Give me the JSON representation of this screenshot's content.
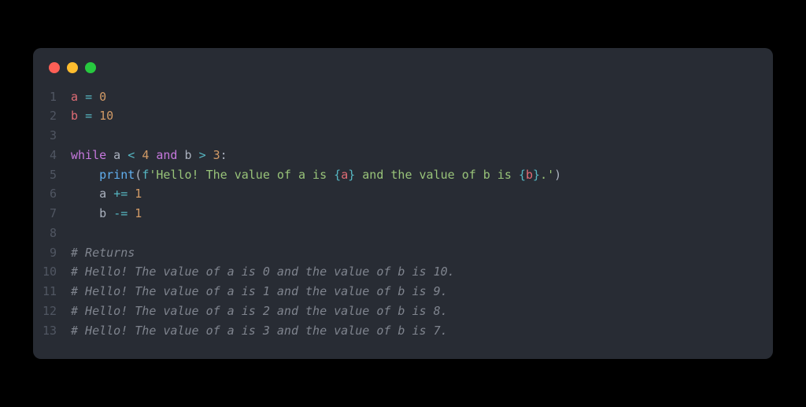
{
  "window": {
    "traffic_lights": [
      "red",
      "yellow",
      "green"
    ]
  },
  "code": {
    "lines": [
      {
        "n": "1",
        "tokens": [
          {
            "t": "a ",
            "c": "tok-var"
          },
          {
            "t": "=",
            "c": "tok-op"
          },
          {
            "t": " ",
            "c": "tok-plain"
          },
          {
            "t": "0",
            "c": "tok-num"
          }
        ]
      },
      {
        "n": "2",
        "tokens": [
          {
            "t": "b ",
            "c": "tok-var"
          },
          {
            "t": "=",
            "c": "tok-op"
          },
          {
            "t": " ",
            "c": "tok-plain"
          },
          {
            "t": "10",
            "c": "tok-num"
          }
        ]
      },
      {
        "n": "3",
        "tokens": []
      },
      {
        "n": "4",
        "tokens": [
          {
            "t": "while",
            "c": "tok-kw"
          },
          {
            "t": " a ",
            "c": "tok-plain"
          },
          {
            "t": "<",
            "c": "tok-op"
          },
          {
            "t": " ",
            "c": "tok-plain"
          },
          {
            "t": "4",
            "c": "tok-num"
          },
          {
            "t": " ",
            "c": "tok-plain"
          },
          {
            "t": "and",
            "c": "tok-kw"
          },
          {
            "t": " b ",
            "c": "tok-plain"
          },
          {
            "t": ">",
            "c": "tok-op"
          },
          {
            "t": " ",
            "c": "tok-plain"
          },
          {
            "t": "3",
            "c": "tok-num"
          },
          {
            "t": ":",
            "c": "tok-plain"
          }
        ]
      },
      {
        "n": "5",
        "tokens": [
          {
            "t": "    ",
            "c": "tok-plain"
          },
          {
            "t": "print",
            "c": "tok-fn"
          },
          {
            "t": "(",
            "c": "tok-plain"
          },
          {
            "t": "f",
            "c": "tok-fstr"
          },
          {
            "t": "'Hello! The value of a is ",
            "c": "tok-str"
          },
          {
            "t": "{",
            "c": "tok-op"
          },
          {
            "t": "a",
            "c": "tok-var"
          },
          {
            "t": "}",
            "c": "tok-op"
          },
          {
            "t": " and the value of b is ",
            "c": "tok-str"
          },
          {
            "t": "{",
            "c": "tok-op"
          },
          {
            "t": "b",
            "c": "tok-var"
          },
          {
            "t": "}",
            "c": "tok-op"
          },
          {
            "t": ".'",
            "c": "tok-str"
          },
          {
            "t": ")",
            "c": "tok-plain"
          }
        ]
      },
      {
        "n": "6",
        "tokens": [
          {
            "t": "    a ",
            "c": "tok-plain"
          },
          {
            "t": "+=",
            "c": "tok-op"
          },
          {
            "t": " ",
            "c": "tok-plain"
          },
          {
            "t": "1",
            "c": "tok-num"
          }
        ]
      },
      {
        "n": "7",
        "tokens": [
          {
            "t": "    b ",
            "c": "tok-plain"
          },
          {
            "t": "-=",
            "c": "tok-op"
          },
          {
            "t": " ",
            "c": "tok-plain"
          },
          {
            "t": "1",
            "c": "tok-num"
          }
        ]
      },
      {
        "n": "8",
        "tokens": []
      },
      {
        "n": "9",
        "tokens": [
          {
            "t": "# Returns",
            "c": "tok-comment"
          }
        ]
      },
      {
        "n": "10",
        "tokens": [
          {
            "t": "# Hello! The value of a is 0 and the value of b is 10.",
            "c": "tok-comment"
          }
        ]
      },
      {
        "n": "11",
        "tokens": [
          {
            "t": "# Hello! The value of a is 1 and the value of b is 9.",
            "c": "tok-comment"
          }
        ]
      },
      {
        "n": "12",
        "tokens": [
          {
            "t": "# Hello! The value of a is 2 and the value of b is 8.",
            "c": "tok-comment"
          }
        ]
      },
      {
        "n": "13",
        "tokens": [
          {
            "t": "# Hello! The value of a is 3 and the value of b is 7.",
            "c": "tok-comment"
          }
        ]
      }
    ]
  }
}
